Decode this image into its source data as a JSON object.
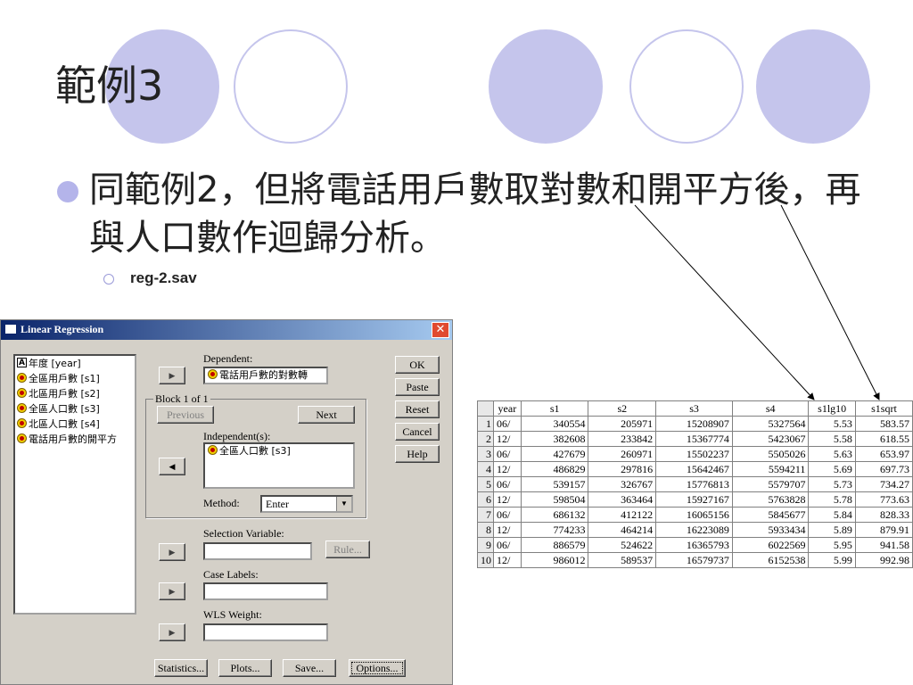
{
  "slide": {
    "title": "範例3",
    "bullet": "同範例2，但將電話用戶數取對數和開平方後，再與人口數作迴歸分析。",
    "sub_bullet": "reg-2.sav"
  },
  "colors": {
    "circle": "#c5c5ec",
    "title_bar": "#0a246a"
  },
  "dialog": {
    "title": "Linear Regression",
    "variables": [
      {
        "label": "年度 [year]",
        "icon": "nominal-icon"
      },
      {
        "label": "全區用戶數 [s1]",
        "icon": "scale-icon"
      },
      {
        "label": "北區用戶數 [s2]",
        "icon": "scale-icon"
      },
      {
        "label": "全區人口數 [s3]",
        "icon": "scale-icon"
      },
      {
        "label": "北區人口數 [s4]",
        "icon": "scale-icon"
      },
      {
        "label": "電話用戶數的開平方",
        "icon": "scale-icon"
      }
    ],
    "dependent_label": "Dependent:",
    "dependent_value": "電話用戶數的對數轉",
    "block_label": "Block 1 of 1",
    "previous": "Previous",
    "next": "Next",
    "independent_label": "Independent(s):",
    "independent_value": "全區人口數 [s3]",
    "method_label": "Method:",
    "method_value": "Enter",
    "selection_label": "Selection Variable:",
    "rule": "Rule...",
    "case_labels": "Case Labels:",
    "wls_label": "WLS Weight:",
    "buttons": {
      "ok": "OK",
      "paste": "Paste",
      "reset": "Reset",
      "cancel": "Cancel",
      "help": "Help"
    },
    "bottom_buttons": {
      "statistics": "Statistics...",
      "plots": "Plots...",
      "save": "Save...",
      "options": "Options..."
    }
  },
  "table": {
    "headers": [
      "year",
      "s1",
      "s2",
      "s3",
      "s4",
      "s1lg10",
      "s1sqrt"
    ],
    "rows": [
      [
        "1",
        "06/",
        "340554",
        "205971",
        "15208907",
        "5327564",
        "5.53",
        "583.57"
      ],
      [
        "2",
        "12/",
        "382608",
        "233842",
        "15367774",
        "5423067",
        "5.58",
        "618.55"
      ],
      [
        "3",
        "06/",
        "427679",
        "260971",
        "15502237",
        "5505026",
        "5.63",
        "653.97"
      ],
      [
        "4",
        "12/",
        "486829",
        "297816",
        "15642467",
        "5594211",
        "5.69",
        "697.73"
      ],
      [
        "5",
        "06/",
        "539157",
        "326767",
        "15776813",
        "5579707",
        "5.73",
        "734.27"
      ],
      [
        "6",
        "12/",
        "598504",
        "363464",
        "15927167",
        "5763828",
        "5.78",
        "773.63"
      ],
      [
        "7",
        "06/",
        "686132",
        "412122",
        "16065156",
        "5845677",
        "5.84",
        "828.33"
      ],
      [
        "8",
        "12/",
        "774233",
        "464214",
        "16223089",
        "5933434",
        "5.89",
        "879.91"
      ],
      [
        "9",
        "06/",
        "886579",
        "524622",
        "16365793",
        "6022569",
        "5.95",
        "941.58"
      ],
      [
        "10",
        "12/",
        "986012",
        "589537",
        "16579737",
        "6152538",
        "5.99",
        "992.98"
      ]
    ]
  }
}
